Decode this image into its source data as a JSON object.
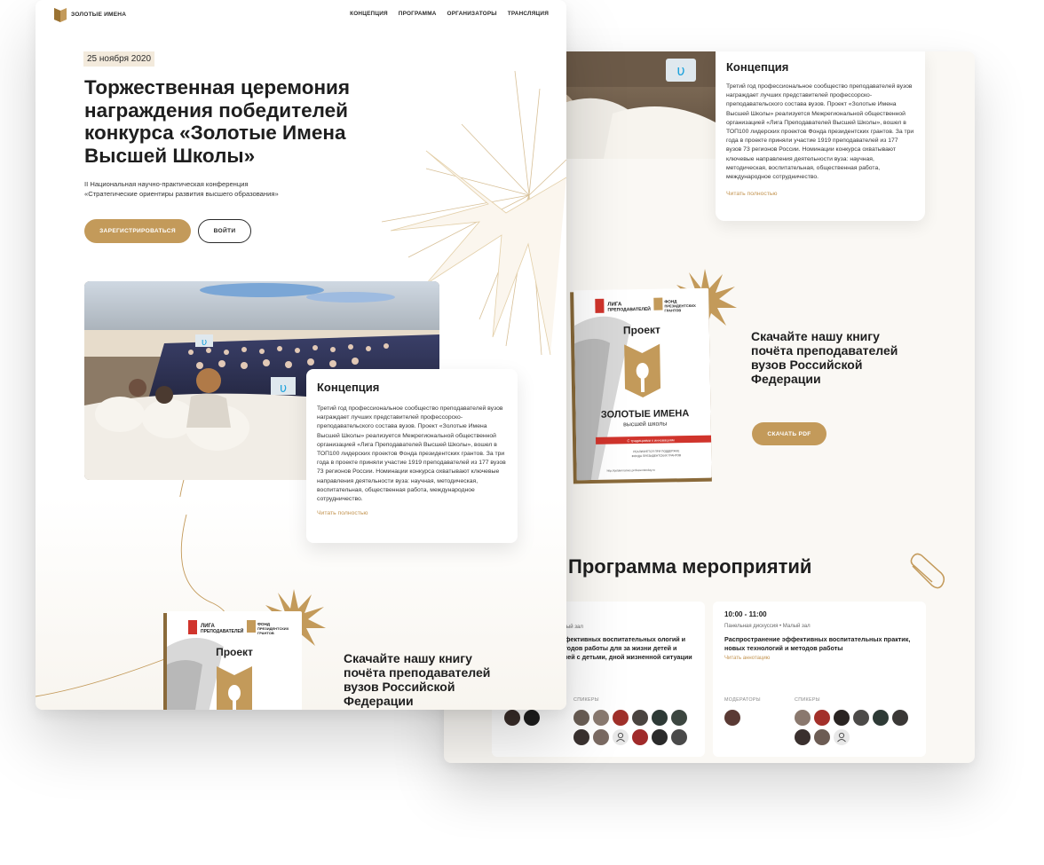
{
  "brand": {
    "name": "ЗОЛОТЫЕ ИМЕНА"
  },
  "nav": {
    "items": [
      "КОНЦЕПЦИЯ",
      "ПРОГРАММА",
      "ОРГАНИЗАТОРЫ",
      "ТРАНСЛЯЦИЯ"
    ]
  },
  "hero": {
    "date": "25 ноября 2020",
    "title": "Торжественная церемония награждения победителей конкурса «Золотые Имена Высшей Школы»",
    "subtitle_line1": "II Национальная научно-практическая конференция",
    "subtitle_line2": "«Стратегические ориентиры развития высшего образования»",
    "register_label": "ЗАРЕГИСТРИРОВАТЬСЯ",
    "login_label": "ВОЙТИ"
  },
  "concept": {
    "title": "Концепция",
    "text": "Третий год профессиональное сообщество преподавателей вузов награждает лучших представителей профессорско-преподавательского состава вузов. Проект «Золотые Имена Высшей Школы» реализуется Межрегиональной общественной организацией «Лига Преподавателей Высшей Школы», вошел в ТОП100 лидерских проектов Фонда президентских грантов. За три года в проекте приняли участие 1919 преподавателей из 177 вузов 73 регионов России. Номинации конкурса охватывают ключевые направления деятельности вуза: научная, методическая, воспитательная, общественная работа, международное сотрудничество.",
    "read_more": "Читать полностью"
  },
  "book": {
    "league": "ЛИГА ПРЕПОДАВАТЕЛЕЙ",
    "fund": "ФОНД ПРЕЗИДЕНТСКИХ ГРАНТОВ",
    "project": "Проект",
    "name": "ЗОЛОТЫЕ ИМЕНА",
    "name_sub": "высшей школы",
    "band": "С традициями к инновациям",
    "footer": "РЕАЛИЗУЕТСЯ ПРИ ПОДДЕРЖКЕ ФОНДА ПРЕЗИДЕНТСКИХ ГРАНТОВ НА РАЗВИТИЕ ГРАЖДАНСКОГО ОБЩЕСТВА",
    "url": "http://goldennames.professorstoday.ru"
  },
  "download": {
    "title": "Скачайте нашу книгу почёта преподавателей вузов Российской Федерации",
    "button": "СКАЧАТЬ PDF"
  },
  "program": {
    "title": "Программа мероприятий",
    "sessions": [
      {
        "time": "",
        "meta": "Малый зал",
        "title": "эффективных воспитательных ологий и методов работы для за жизни детей и семей с детьми, дной жизненной ситуации",
        "more": "",
        "moderators_label": "",
        "speakers_label": "СПИКЕРЫ"
      },
      {
        "time": "10:00 - 11:00",
        "meta": "Панельная дискуссия  •  Малый зал",
        "title": "Распространение эффективных воспитательных практик, новых технологий и методов работы",
        "more": "Читать аннотацию",
        "moderators_label": "МОДЕРАТОРЫ",
        "speakers_label": "СПИКЕРЫ"
      }
    ]
  },
  "colors": {
    "accent": "#c39a5a",
    "date_bg": "#f3eadc",
    "link": "#c39451"
  },
  "icons": [
    "book-logo-icon",
    "star-burst-icon",
    "paperclip-icon",
    "person-placeholder-icon"
  ]
}
